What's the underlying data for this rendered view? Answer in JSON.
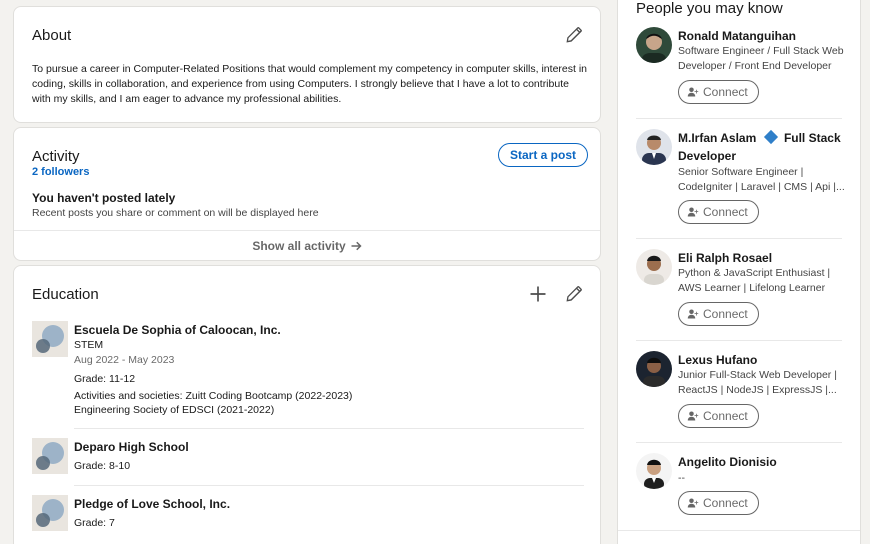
{
  "about": {
    "title": "About",
    "text": "To pursue a career in Computer-Related Positions that would complement my competency in computer skills, interest in coding, skills in collaboration, and experience from using Computers. I strongly believe that I have a lot to contribute with my skills, and I am eager to advance my professional abilities."
  },
  "activity": {
    "title": "Activity",
    "followers": "2 followers",
    "start_post": "Start a post",
    "empty_title": "You haven't posted lately",
    "empty_sub": "Recent posts you share or comment on will be displayed here",
    "show_all": "Show all activity"
  },
  "education": {
    "title": "Education",
    "items": [
      {
        "school": "Escuela De Sophia of Caloocan, Inc.",
        "degree": "STEM",
        "dates": "Aug 2022 - May 2023",
        "grade": "Grade: 11-12",
        "activities_1": "Activities and societies: Zuitt Coding Bootcamp (2022-2023)",
        "activities_2": "Engineering Society of EDSCI (2021-2022)"
      },
      {
        "school": "Deparo High School",
        "grade": "Grade: 8-10"
      },
      {
        "school": "Pledge of Love School, Inc.",
        "grade": "Grade: 7"
      }
    ]
  },
  "people": {
    "title": "People you may know",
    "connect_label": "Connect",
    "list": [
      {
        "name": "Ronald Matanguihan",
        "headline": "Software Engineer / Full Stack Web Developer / Front End Developer",
        "avatar_color": "#2f4a3a"
      },
      {
        "name": "M.Irfan Aslam",
        "name_suffix": "Full Stack",
        "name_line2": "Developer",
        "headline_1": "Senior Software Engineer |",
        "headline_2": "CodeIgniter | Laravel | CMS | Api |...",
        "avatar_color": "#3b4b6b"
      },
      {
        "name": "Eli Ralph Rosael",
        "headline": "Python & JavaScript Enthusiast | AWS Learner | Lifelong Learner",
        "avatar_color": "#e8e4df"
      },
      {
        "name": "Lexus Hufano",
        "headline_1": "Junior Full-Stack Web Developer |",
        "headline_2": "ReactJS | NodeJS | ExpressJS |...",
        "avatar_color": "#1c2430"
      },
      {
        "name": "Angelito Dionisio",
        "headline": "--",
        "avatar_color": "#f4f4f4"
      }
    ]
  },
  "colors": {
    "accent": "#0a66c2",
    "background": "#f3f2ef"
  },
  "icons": {
    "edit": "pencil-icon",
    "add": "plus-icon",
    "connect": "person-add-icon",
    "arrow": "arrow-right-icon"
  }
}
